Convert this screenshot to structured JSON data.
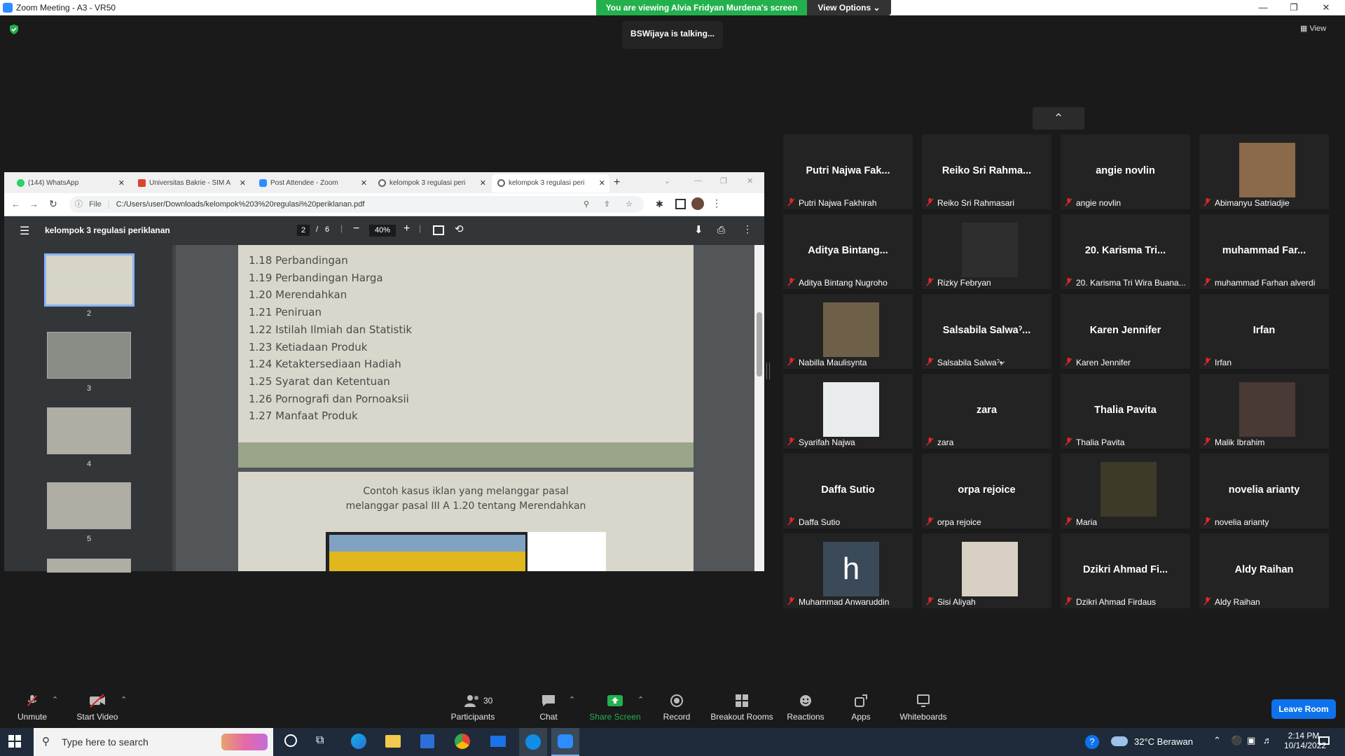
{
  "window": {
    "title": "Zoom Meeting - A3 - VR50"
  },
  "banner": {
    "viewing_text": "You are viewing Alvia Fridyan Murdena's screen",
    "view_options": "View Options"
  },
  "talking": "BSWijaya is talking...",
  "view_button": "View",
  "browser": {
    "tabs": [
      {
        "label": "(144) WhatsApp",
        "color": "#25d366"
      },
      {
        "label": "Universitas Bakrie - SIM A",
        "color": "#d9442e"
      },
      {
        "label": "Post Attendee - Zoom",
        "color": "#2d8cff"
      },
      {
        "label": "kelompok 3 regulasi peri",
        "color": "#555555"
      },
      {
        "label": "kelompok 3 regulasi peri",
        "color": "#555555"
      }
    ],
    "url_prefix": "File",
    "url": "C:/Users/user/Downloads/kelompok%203%20regulasi%20periklanan.pdf"
  },
  "pdf": {
    "title": "kelompok 3 regulasi periklanan",
    "page_current": "2",
    "page_sep": "/",
    "page_total": "6",
    "zoom": "40%",
    "thumb_numbers": [
      "2",
      "3",
      "4",
      "5"
    ],
    "toc": [
      "1.18 Perbandingan",
      "1.19 Perbandingan Harga",
      "1.20 Merendahkan",
      "1.21 Peniruan",
      "1.22 Istilah Ilmiah dan Statistik",
      "1.23 Ketiadaan Produk",
      "1.24 Ketaktersediaan Hadiah",
      "1.25 Syarat dan Ketentuan",
      "1.26 Pornografi dan Pornoaksii",
      "1.27 Manfaat Produk"
    ],
    "case_line1": "Contoh kasus iklan yang melanggar pasal",
    "case_line2": "melanggar pasal III A 1.20 tentang Merendahkan"
  },
  "participants_tiles": [
    {
      "big": "Putri Najwa Fak...",
      "name": "Putri Najwa Fakhirah",
      "photo": false
    },
    {
      "big": "Reiko Sri Rahma...",
      "name": "Reiko Sri Rahmasari",
      "photo": false
    },
    {
      "big": "angie novlin",
      "name": "angie novlin",
      "photo": false
    },
    {
      "big": "",
      "name": "Abimanyu Satriadjie",
      "photo": true,
      "photo_color": "#8a6a4a"
    },
    {
      "big": "Aditya  Bintang...",
      "name": "Aditya Bintang Nugroho",
      "photo": false
    },
    {
      "big": "",
      "name": "Rizky Febryan",
      "photo": true,
      "photo_color": "#2e2e2e"
    },
    {
      "big": "20. Karisma Tri...",
      "name": "20. Karisma Tri Wira Buana...",
      "photo": false
    },
    {
      "big": "muhammad  Far...",
      "name": "muhammad Farhan alverdi",
      "photo": false
    },
    {
      "big": "",
      "name": "Nabilla Maulisynta",
      "photo": true,
      "photo_color": "#6e6048"
    },
    {
      "big": "Salsabila  Salwaˀ...",
      "name": "Salsabila Salwaˀ•̷",
      "photo": false
    },
    {
      "big": "Karen Jennifer",
      "name": "Karen Jennifer",
      "photo": false
    },
    {
      "big": "Irfan",
      "name": "Irfan",
      "photo": false
    },
    {
      "big": "",
      "name": "Syarifah Najwa",
      "photo": true,
      "photo_color": "#e8ecec"
    },
    {
      "big": "zara",
      "name": "zara",
      "photo": false
    },
    {
      "big": "Thalia Pavita",
      "name": "Thalia Pavita",
      "photo": false
    },
    {
      "big": "",
      "name": "Malik Ibrahim",
      "photo": true,
      "photo_color": "#4a3a35"
    },
    {
      "big": "Daffa Sutio",
      "name": "Daffa Sutio",
      "photo": false
    },
    {
      "big": "orpa rejoice",
      "name": "orpa rejoice",
      "photo": false
    },
    {
      "big": "",
      "name": "Maria",
      "photo": true,
      "photo_color": "#3d3a2a"
    },
    {
      "big": "novelia arianty",
      "name": "novelia arianty",
      "photo": false
    },
    {
      "big": "",
      "name": "Muhammad Anwaruddin",
      "photo": true,
      "photo_color": "#3b4a58",
      "letter": "h"
    },
    {
      "big": "",
      "name": "Sisi Aliyah",
      "photo": true,
      "photo_color": "#d8d0c4"
    },
    {
      "big": "Dzikri  Ahmad  Fi...",
      "name": "Dzikri Ahmad Firdaus",
      "photo": false
    },
    {
      "big": "Aldy Raihan",
      "name": "Aldy Raihan",
      "photo": false
    }
  ],
  "toolbar": {
    "unmute": "Unmute",
    "start_video": "Start Video",
    "participants": "Participants",
    "participants_count": "30",
    "chat": "Chat",
    "share_screen": "Share Screen",
    "record": "Record",
    "breakout": "Breakout Rooms",
    "reactions": "Reactions",
    "apps": "Apps",
    "whiteboards": "Whiteboards",
    "leave": "Leave Room"
  },
  "taskbar": {
    "search_placeholder": "Type here to search",
    "weather": "32°C  Berawan",
    "time": "2:14 PM",
    "date": "10/14/2022"
  }
}
